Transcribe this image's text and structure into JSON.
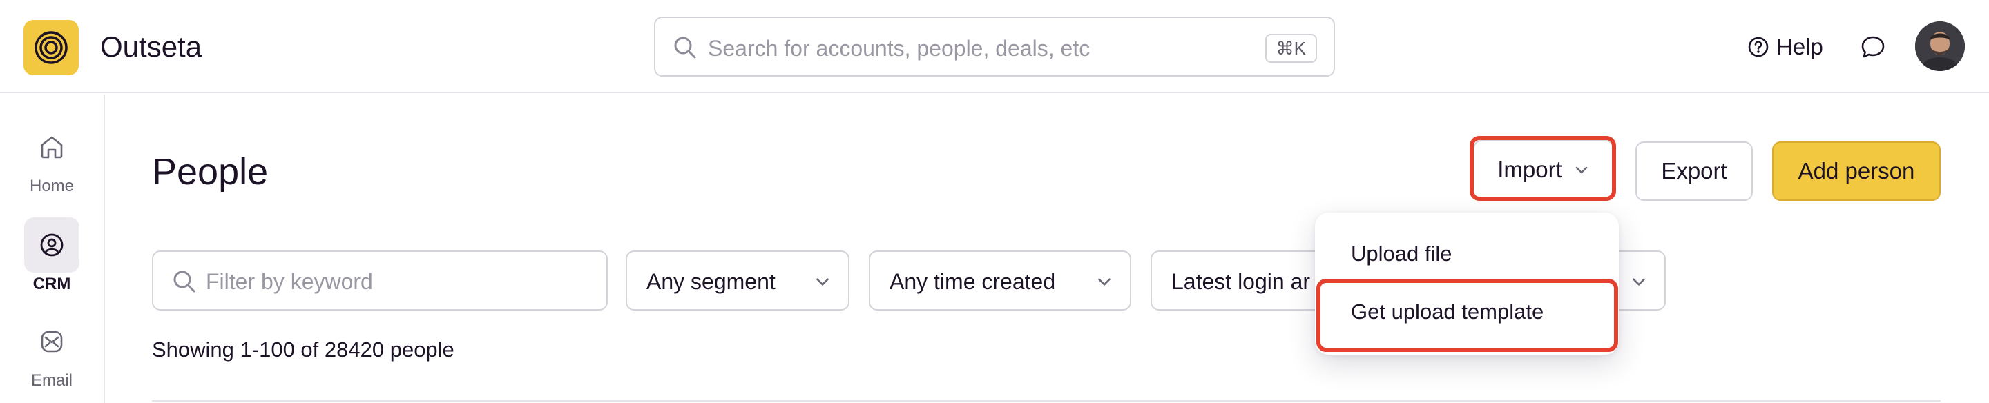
{
  "header": {
    "brand": "Outseta",
    "search_placeholder": "Search for accounts, people, deals, etc",
    "search_shortcut": "⌘K",
    "help_label": "Help",
    "icons": [
      "logo-icon",
      "search-icon",
      "help-icon",
      "chat-icon",
      "avatar"
    ]
  },
  "sidebar": {
    "items": [
      {
        "label": "Home",
        "icon": "home-icon"
      },
      {
        "label": "CRM",
        "icon": "crm-icon",
        "active": true
      },
      {
        "label": "Email",
        "icon": "email-icon"
      }
    ]
  },
  "main": {
    "title": "People",
    "import_label": "Import",
    "export_label": "Export",
    "add_label": "Add person",
    "filter_placeholder": "Filter by keyword",
    "segment_label": "Any segment",
    "time_label": "Any time created",
    "login_label": "Latest login ar",
    "showing": "Showing 1-100 of 28420 people"
  },
  "import_menu": {
    "items": [
      "Upload file",
      "Get upload template"
    ],
    "highlighted": "Get upload template"
  },
  "colors": {
    "accent": "#f3c841",
    "highlight": "#e4402d",
    "text": "#1d1326"
  }
}
